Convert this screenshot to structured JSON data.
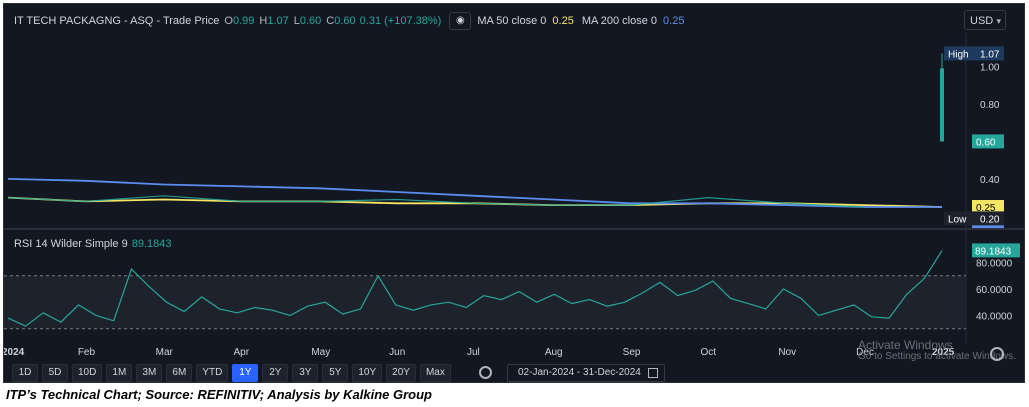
{
  "legend": {
    "symbol": "IT TECH PACKAGNG - ASQ - Trade Price",
    "o_label": "O",
    "o_val": "0.99",
    "h_label": "H",
    "h_val": "1.07",
    "l_label": "L",
    "l_val": "0.60",
    "c_label": "C",
    "c_val": "0.60",
    "change": "0.31 (+107.38%)",
    "ma50": "MA 50 close 0",
    "ma50_val": "0.25",
    "ma200": "MA 200 close 0",
    "ma200_val": "0.25"
  },
  "currency": "USD",
  "rsi_legend": {
    "label": "RSI 14 Wilder Simple 9",
    "value": "89.1843"
  },
  "toolbar": {
    "ranges": [
      "1D",
      "5D",
      "10D",
      "1M",
      "3M",
      "6M",
      "YTD",
      "1Y",
      "2Y",
      "3Y",
      "5Y",
      "10Y",
      "20Y",
      "Max"
    ],
    "active": "1Y",
    "date_range": "02-Jan-2024  -  31-Dec-2024"
  },
  "watermark": {
    "title": "Activate Windows",
    "sub": "Go to Settings to activate Windows."
  },
  "caption": "ITP’s Technical Chart; Source: REFINITIV; Analysis by Kalkine Group",
  "colors": {
    "bg": "#131722",
    "up": "#26a69a",
    "down": "#ef5350",
    "ma50": "#f5e663",
    "ma200": "#5b8def",
    "rsi": "#26a69a"
  },
  "chart_data": {
    "type": "line",
    "price_axis": {
      "ticks": [
        "1.00",
        "0.80",
        "0.40"
      ],
      "ylim": [
        0.17,
        1.12
      ]
    },
    "price_labels": {
      "high_label": "High",
      "high": "1.07",
      "close": "0.60",
      "ma50": "0.25",
      "ma200": "0.25",
      "low_label": "Low",
      "low": "0.20"
    },
    "x_ticks": [
      "2024",
      "Feb",
      "Mar",
      "Apr",
      "May",
      "Jun",
      "Jul",
      "Aug",
      "Sep",
      "Oct",
      "Nov",
      "Dec",
      "2025"
    ],
    "series": [
      {
        "name": "Trade Price",
        "x": [
          "2024",
          "Feb",
          "Mar",
          "Apr",
          "May",
          "Jun",
          "Jul",
          "Aug",
          "Sep",
          "Oct",
          "Nov",
          "Dec",
          "2025"
        ],
        "values": [
          0.3,
          0.28,
          0.31,
          0.28,
          0.28,
          0.29,
          0.27,
          0.26,
          0.26,
          0.3,
          0.27,
          0.25,
          0.6
        ]
      },
      {
        "name": "MA 50 close 0",
        "x": [
          "2024",
          "Feb",
          "Mar",
          "Apr",
          "May",
          "Jun",
          "Jul",
          "Aug",
          "Sep",
          "Oct",
          "Nov",
          "Dec",
          "2025"
        ],
        "values": [
          0.3,
          0.28,
          0.29,
          0.28,
          0.28,
          0.27,
          0.27,
          0.26,
          0.26,
          0.27,
          0.27,
          0.26,
          0.25
        ]
      },
      {
        "name": "MA 200 close 0",
        "x": [
          "2024",
          "Feb",
          "Mar",
          "Apr",
          "May",
          "Jun",
          "Jul",
          "Aug",
          "Sep",
          "Oct",
          "Nov",
          "Dec",
          "2025"
        ],
        "values": [
          0.4,
          0.39,
          0.37,
          0.36,
          0.35,
          0.33,
          0.31,
          0.29,
          0.27,
          0.27,
          0.26,
          0.25,
          0.25
        ]
      }
    ],
    "rsi": {
      "label": "RSI 14 Wilder Simple 9",
      "axis_ticks": [
        "80.0000",
        "60.0000",
        "40.0000"
      ],
      "ylim": [
        26,
        94
      ],
      "last": "89.1843",
      "values": [
        38,
        32,
        42,
        35,
        48,
        40,
        36,
        75,
        62,
        50,
        43,
        54,
        45,
        42,
        46,
        44,
        40,
        47,
        50,
        41,
        45,
        70,
        48,
        44,
        48,
        50,
        46,
        55,
        52,
        58,
        50,
        56,
        49,
        52,
        47,
        50,
        57,
        65,
        55,
        59,
        66,
        53,
        49,
        45,
        60,
        53,
        40,
        44,
        48,
        39,
        38,
        56,
        68,
        89
      ]
    },
    "grid": false,
    "legend_position": "top-left"
  }
}
